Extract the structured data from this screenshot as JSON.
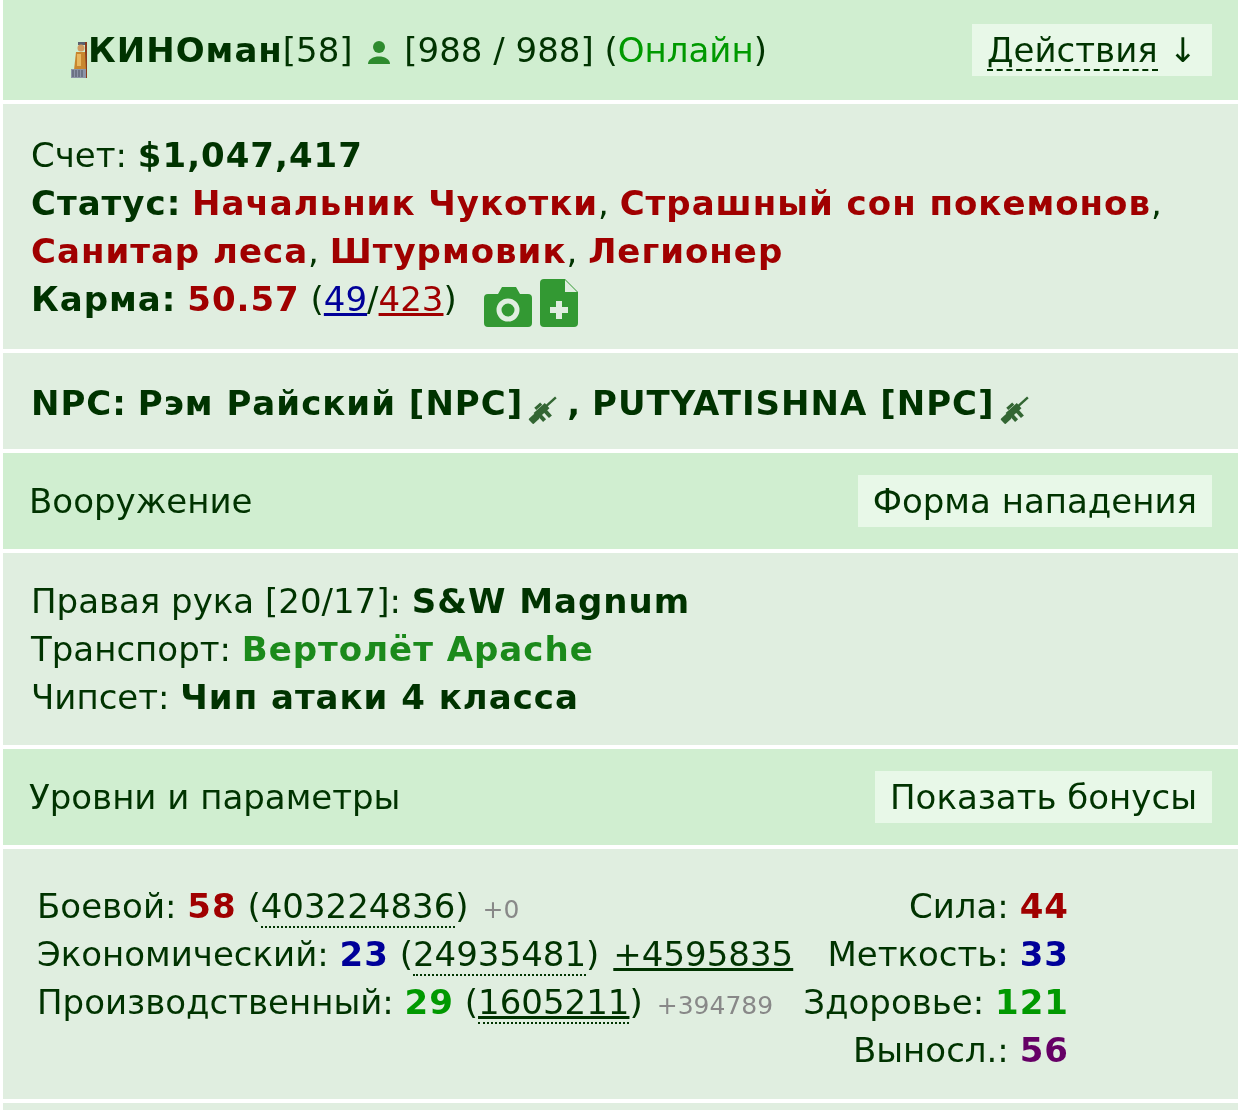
{
  "header": {
    "name": "КИНОман",
    "level": "[58]",
    "health": "[988 / 988]",
    "online": {
      "open": "(",
      "text": "Онлайн",
      "close": ")",
      "on": true
    },
    "actions": {
      "label": "Действия",
      "arrow": "↓"
    }
  },
  "account": {
    "balance_label": "Счет:",
    "balance": "$1,047,417",
    "status_label": "Статус:",
    "statuses": [
      {
        "text": "Начальник Чукотки",
        "separator": ","
      },
      {
        "text": "Страшный сон покемонов",
        "separator": ","
      },
      {
        "text": "Санитар леса",
        "separator": ","
      },
      {
        "text": "Штурмовик",
        "separator": ","
      },
      {
        "text": "Легионер"
      }
    ],
    "karma": {
      "label": "Карма:",
      "value": "50.57",
      "open": "(",
      "plus": "49",
      "slash": "/",
      "minus": "423",
      "close": ")"
    }
  },
  "npc": {
    "label": "NPC:",
    "npcs": [
      {
        "name": "Рэм Райский [NPC]",
        "separator": ","
      },
      {
        "name": "PUTYATISHNA [NPC]"
      }
    ]
  },
  "weapons": {
    "title": "Вооружение",
    "button": "Форма нападения",
    "items": [
      {
        "label": "Правая рука [20/17]:",
        "value": "S&W Magnum",
        "color": "#003300"
      },
      {
        "label": "Транспорт:",
        "value": "Вертолёт Apache",
        "color": "#1b8a1b"
      },
      {
        "label": "Чипсет:",
        "value": "Чип атаки 4 класса",
        "color": "#003300"
      }
    ]
  },
  "levels": {
    "title": "Уровни и параметры",
    "button": "Показать бонусы",
    "rows": [
      {
        "label": "Боевой:",
        "value": "58",
        "color": "#a00000",
        "open": "(",
        "exp": "403224836",
        "exp_linked": false,
        "close": ")",
        "bonus": {
          "kind": "minor",
          "text": "+0"
        }
      },
      {
        "label": "Экономический:",
        "value": "23",
        "color": "#000099",
        "open": "(",
        "exp": "24935481",
        "exp_linked": false,
        "close": ")",
        "bonus": {
          "kind": "link",
          "text": "+4595835"
        }
      },
      {
        "label": "Производственный:",
        "value": "29",
        "color": "#009900",
        "open": "(",
        "exp": "1605211",
        "exp_linked": true,
        "close": ")",
        "bonus": {
          "kind": "minor",
          "text": "+394789"
        }
      }
    ],
    "attributes": [
      {
        "label": "Сила:",
        "value": "44",
        "color": "#a00000"
      },
      {
        "label": "Меткость:",
        "value": "33",
        "color": "#000099"
      },
      {
        "label": "Здоровье:",
        "value": "121",
        "color": "#009900"
      },
      {
        "label": "Выносл.:",
        "value": "56",
        "color": "#660066"
      }
    ]
  }
}
